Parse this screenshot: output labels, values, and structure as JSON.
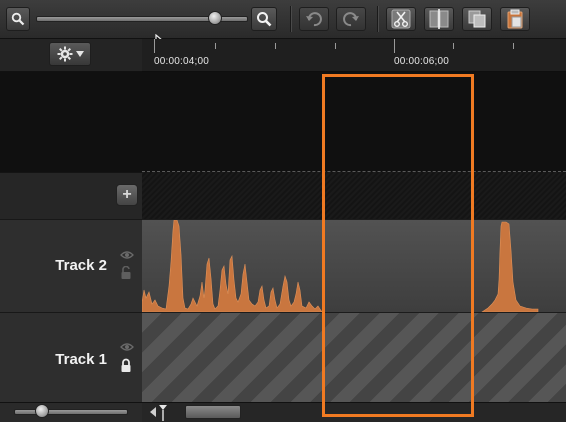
{
  "toolbar": {
    "zoom_out_icon": "zoom-out-icon",
    "zoom_in_icon": "zoom-in-icon",
    "zoom_level": 0.85,
    "tools": [
      "undo-icon",
      "redo-icon",
      "cut-icon",
      "split-icon",
      "copy-icon",
      "paste-icon"
    ]
  },
  "ruler": {
    "labels": [
      "00:00:04;00",
      "00:00:06;00"
    ]
  },
  "tracks": [
    {
      "name": "Track 2",
      "visibility_icon": "eye-icon",
      "lock_icon": "unlock-icon",
      "content": "audio-waveform"
    },
    {
      "name": "Track 1",
      "visibility_icon": "eye-icon",
      "lock_icon": "lock-icon",
      "content": "empty-clip"
    }
  ],
  "add_track_label": "+",
  "colors": {
    "waveform": "#c9763f",
    "highlight": "#f07a22"
  },
  "bottom": {
    "track_height_level": 0.25
  }
}
